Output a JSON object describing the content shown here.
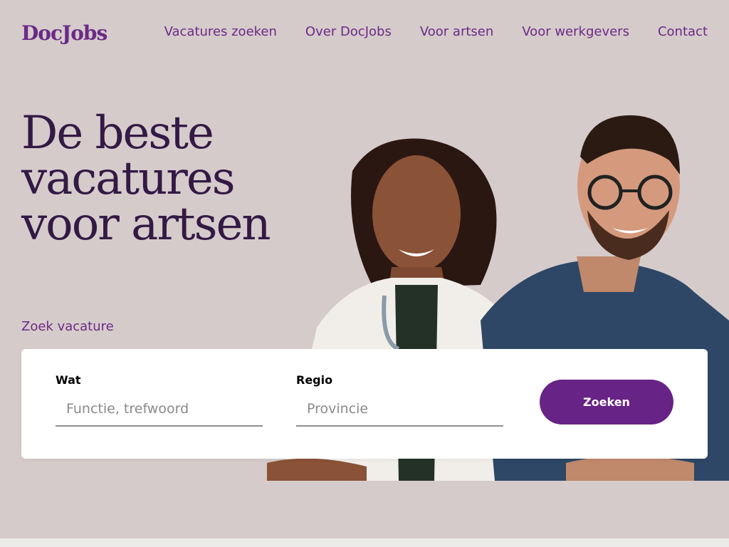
{
  "brand": {
    "logo": "DocJobs"
  },
  "nav": [
    {
      "label": "Vacatures zoeken"
    },
    {
      "label": "Over DocJobs"
    },
    {
      "label": "Voor artsen"
    },
    {
      "label": "Voor werkgevers"
    },
    {
      "label": "Contact"
    }
  ],
  "hero": {
    "title_line1": "De beste",
    "title_line2": "vacatures",
    "title_line3": "voor artsen",
    "search_heading": "Zoek vacature"
  },
  "search": {
    "wat_label": "Wat",
    "wat_placeholder": "Functie, trefwoord",
    "regio_label": "Regio",
    "regio_placeholder": "Provincie",
    "button": "Zoeken"
  },
  "colors": {
    "background": "#d6cbcb",
    "brand_purple": "#6a2a86",
    "title": "#331a45",
    "button": "#672385"
  },
  "icons": []
}
